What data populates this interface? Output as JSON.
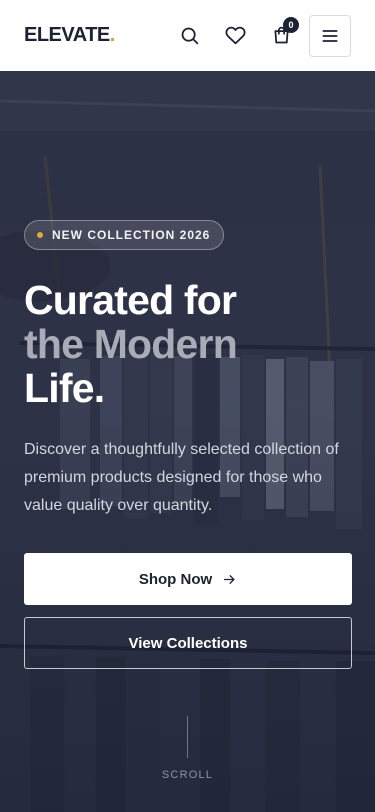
{
  "header": {
    "logo": "ELEVATE",
    "logo_dot": ".",
    "cart_count": "0"
  },
  "icons": {
    "search": "search-icon",
    "wishlist": "heart-icon",
    "cart": "shopping-bag-icon",
    "menu": "hamburger-menu-icon",
    "arrow": "arrow-right-icon"
  },
  "hero": {
    "badge": "NEW COLLECTION 2026",
    "headline_line1": "Curated for",
    "headline_line2": "the Modern",
    "headline_line3": "Life.",
    "description": "Discover a thoughtfully selected collection of premium products designed for those who value quality over quantity.",
    "primary_button": "Shop Now",
    "secondary_button": "View Collections",
    "scroll_label": "SCROLL"
  },
  "colors": {
    "brand_dark": "#1d2233",
    "accent": "#e0a83a",
    "headline_muted": "#a9acb6"
  }
}
